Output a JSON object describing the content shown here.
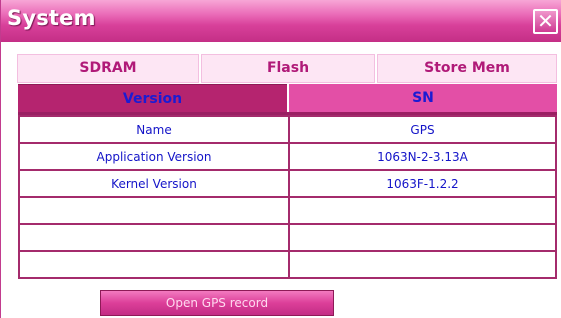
{
  "window": {
    "title": "System",
    "close_glyph": "✕"
  },
  "tabs": [
    {
      "label": "SDRAM"
    },
    {
      "label": "Flash"
    },
    {
      "label": "Store Mem"
    }
  ],
  "subtabs": [
    {
      "label": "Version",
      "active": true
    },
    {
      "label": "SN",
      "active": false
    }
  ],
  "table": {
    "rows": [
      {
        "name": "Name",
        "value": "GPS"
      },
      {
        "name": "Application Version",
        "value": "1063N-2-3.13A"
      },
      {
        "name": "Kernel Version",
        "value": "1063F-1.2.2"
      },
      {
        "name": "",
        "value": ""
      },
      {
        "name": "",
        "value": ""
      },
      {
        "name": "",
        "value": ""
      }
    ]
  },
  "footer": {
    "button_label": "Open GPS record"
  },
  "colors": {
    "accent": "#d8409a",
    "active_tab": "#b5246f",
    "text": "#1414c8"
  }
}
